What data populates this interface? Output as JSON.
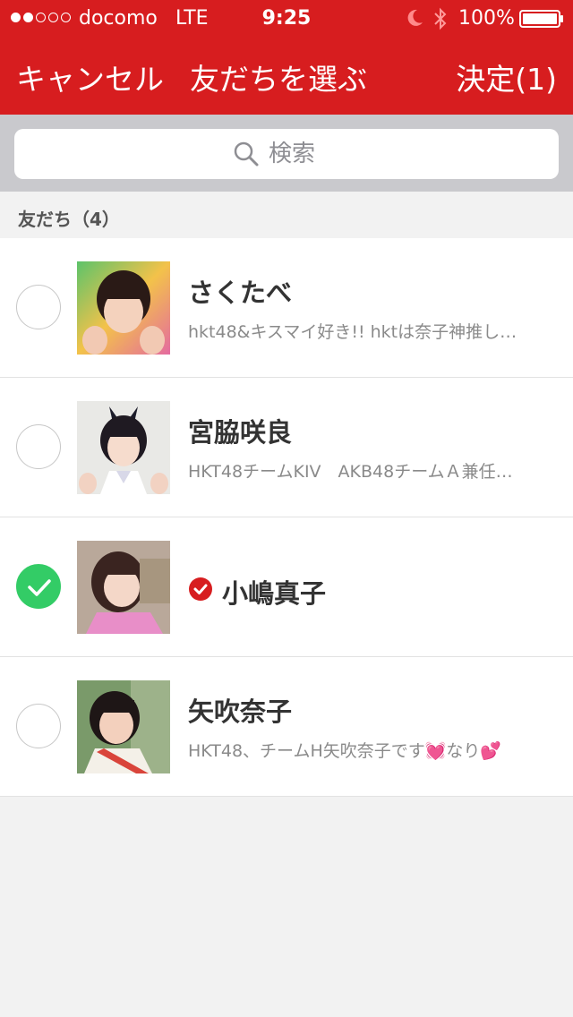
{
  "status_bar": {
    "carrier": "docomo",
    "network": "LTE",
    "time": "9:25",
    "battery": "100%",
    "signal_bars": 2,
    "icons": [
      "moon-icon",
      "bluetooth-icon",
      "battery-icon"
    ]
  },
  "nav": {
    "cancel_label": "キャンセル",
    "title": "友だちを選ぶ",
    "confirm_label": "決定(1)"
  },
  "search": {
    "placeholder": "検索",
    "icon": "search-icon"
  },
  "section": {
    "label": "友だち（4）"
  },
  "friends": [
    {
      "name": "さくたべ",
      "status": "hkt48&キスマイ好き!! hktは奈子神推し…",
      "selected": false,
      "badge": false
    },
    {
      "name": "宮脇咲良",
      "status": "HKT48チームKIV　AKB48チームＡ兼任…",
      "selected": false,
      "badge": false
    },
    {
      "name": "小嶋真子",
      "status": "",
      "selected": true,
      "badge": true
    },
    {
      "name": "矢吹奈子",
      "status": "HKT48、チームH矢吹奈子です💓なり💕",
      "selected": false,
      "badge": false
    }
  ],
  "colors": {
    "header": "#d71d1f",
    "selected_check": "#33cc66",
    "badge": "#d71d1f"
  }
}
